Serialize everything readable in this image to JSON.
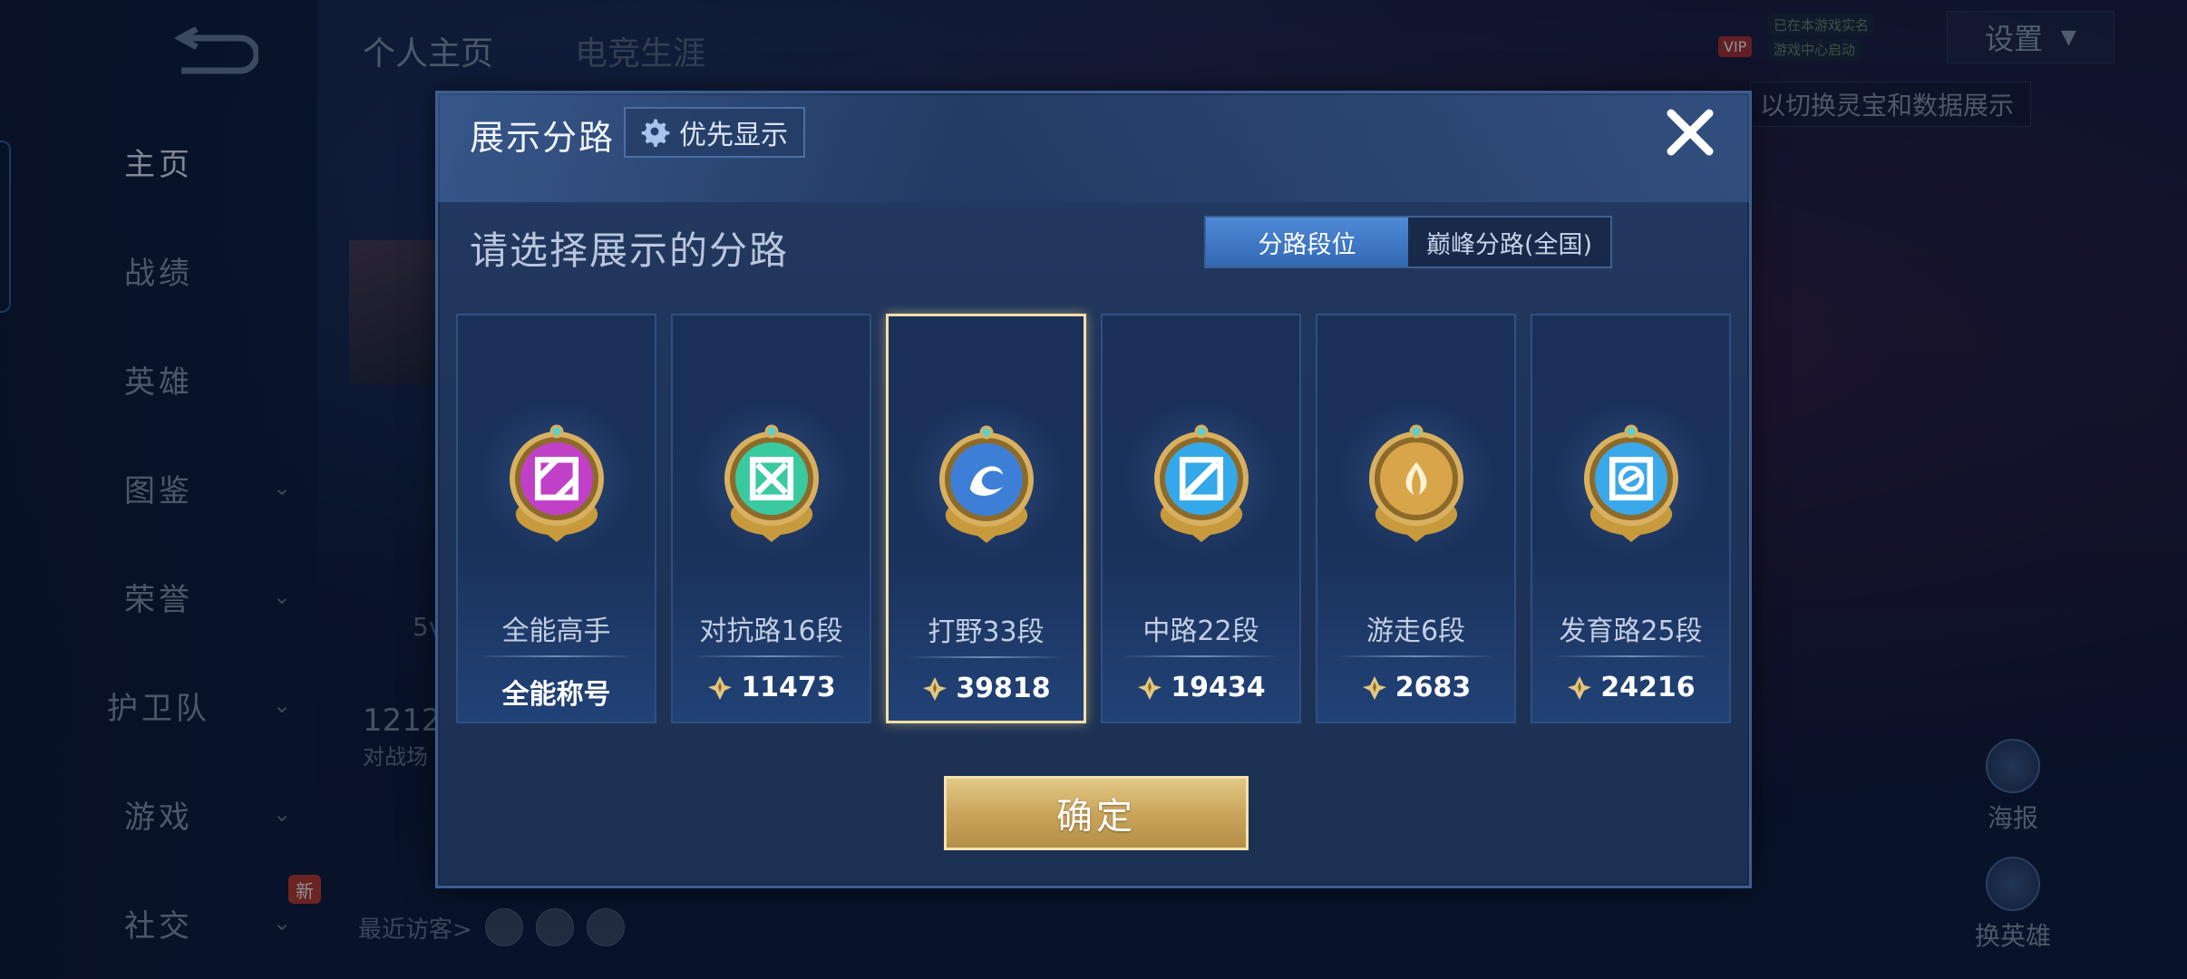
{
  "background": {
    "top_tabs": [
      "个人主页",
      "电竞生涯"
    ],
    "sidebar": [
      {
        "label": "主页",
        "active": true,
        "chevron": false
      },
      {
        "label": "战绩",
        "active": false,
        "chevron": false
      },
      {
        "label": "英雄",
        "active": false,
        "chevron": false
      },
      {
        "label": "图鉴",
        "active": false,
        "chevron": true
      },
      {
        "label": "荣誉",
        "active": false,
        "chevron": true
      },
      {
        "label": "护卫队",
        "active": false,
        "chevron": true
      },
      {
        "label": "游戏",
        "active": false,
        "chevron": true
      },
      {
        "label": "社交",
        "active": false,
        "chevron": true
      }
    ],
    "new_badge": "新",
    "settings_label": "设置",
    "vip_tag": "VIP",
    "vip_line1": "已在本游戏实名",
    "vip_line2": "游戏中心启动",
    "hint": "以切换灵宝和数据展示",
    "poster_label": "海报",
    "swap_hero_label": "换英雄",
    "stat_number": "1212",
    "stat_label": "对战场",
    "mode_text": "5v",
    "recent_visitors": "最近访客>"
  },
  "modal": {
    "title": "展示分路",
    "priority_label": "优先显示",
    "subtitle": "请选择展示的分路",
    "segments": [
      {
        "label": "分路段位",
        "active": true
      },
      {
        "label": "巅峰分路(全国)",
        "active": false
      }
    ],
    "cards": [
      {
        "name": "全能高手",
        "value": "全能称号",
        "show_points_icon": false,
        "emblem": "all-round-emblem-icon",
        "color": "#c040c8",
        "selected": false
      },
      {
        "name": "对抗路16段",
        "value": "11473",
        "show_points_icon": true,
        "emblem": "clash-lane-emblem-icon",
        "color": "#3bc9a0",
        "selected": false
      },
      {
        "name": "打野33段",
        "value": "39818",
        "show_points_icon": true,
        "emblem": "jungle-emblem-icon",
        "color": "#3d7fd6",
        "selected": true
      },
      {
        "name": "中路22段",
        "value": "19434",
        "show_points_icon": true,
        "emblem": "mid-lane-emblem-icon",
        "color": "#34a8e8",
        "selected": false
      },
      {
        "name": "游走6段",
        "value": "2683",
        "show_points_icon": true,
        "emblem": "roam-emblem-icon",
        "color": "#d9a54a",
        "selected": false
      },
      {
        "name": "发育路25段",
        "value": "24216",
        "show_points_icon": true,
        "emblem": "farm-lane-emblem-icon",
        "color": "#3aa8ea",
        "selected": false
      }
    ],
    "confirm_label": "确定"
  }
}
